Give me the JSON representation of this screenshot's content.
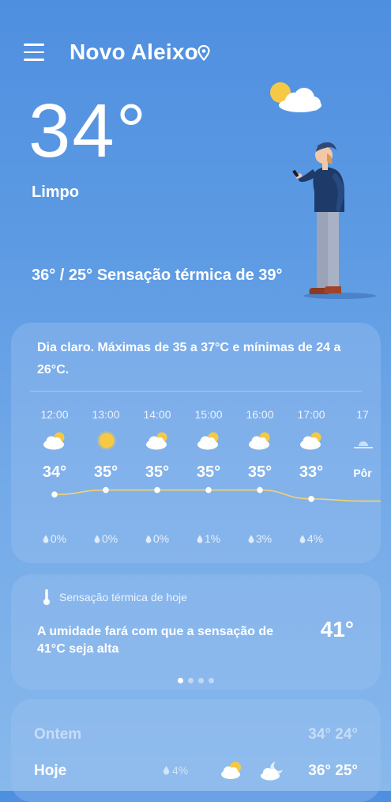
{
  "header": {
    "location": "Novo Aleixo",
    "menu_icon": "hamburger-menu-icon",
    "location_icon": "map-pin-icon"
  },
  "current": {
    "temperature": "34°",
    "condition": "Limpo",
    "hilo_feels": "36° / 25° Sensação térmica de 39°"
  },
  "hourly_card": {
    "summary": "Dia claro. Máximas de 35 a 37°C e mínimas de 24 a 26°C.",
    "hours": [
      {
        "time": "12:00",
        "icon": "partly-cloudy-icon",
        "temp": "34°",
        "temp_value": 34,
        "rain": "0%"
      },
      {
        "time": "13:00",
        "icon": "sun-icon",
        "temp": "35°",
        "temp_value": 35,
        "rain": "0%"
      },
      {
        "time": "14:00",
        "icon": "partly-cloudy-icon",
        "temp": "35°",
        "temp_value": 35,
        "rain": "0%"
      },
      {
        "time": "15:00",
        "icon": "partly-cloudy-icon",
        "temp": "35°",
        "temp_value": 35,
        "rain": "1%"
      },
      {
        "time": "16:00",
        "icon": "partly-cloudy-icon",
        "temp": "35°",
        "temp_value": 35,
        "rain": "3%"
      },
      {
        "time": "17:00",
        "icon": "partly-cloudy-icon",
        "temp": "33°",
        "temp_value": 33,
        "rain": "4%"
      },
      {
        "time": "17",
        "icon": "sunset-icon",
        "temp": "Pôr",
        "temp_value": 32.5,
        "rain": ""
      }
    ]
  },
  "feels_card": {
    "header": "Sensação térmica de hoje",
    "text": "A umidade fará com que a sensação de 41°C seja alta",
    "value": "41°",
    "pages": 4,
    "active_page": 0
  },
  "daily": [
    {
      "day": "Ontem",
      "rain": "",
      "temps": "34° 24°"
    },
    {
      "day": "Hoje",
      "rain": "4%",
      "temps": "36° 25°"
    }
  ],
  "colors": {
    "sun": "#f6c945",
    "trend_line": "#f2d36b"
  }
}
